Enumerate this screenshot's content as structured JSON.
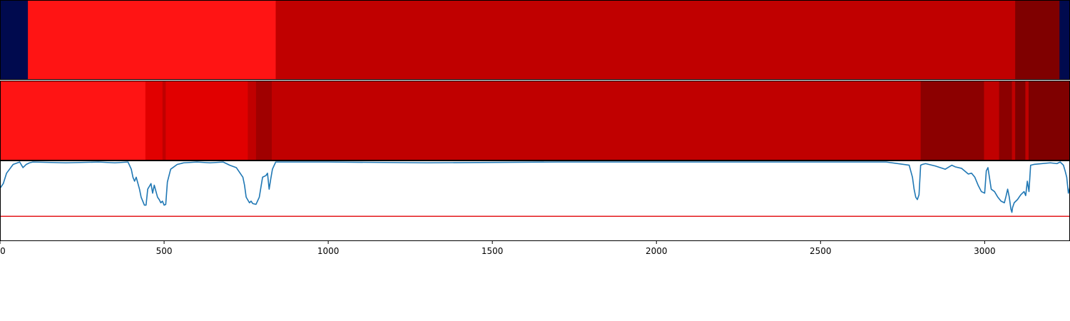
{
  "chart_data": {
    "type": "heatmap",
    "x_ticks": [
      0,
      500,
      1000,
      1500,
      2000,
      2500,
      3000
    ],
    "xlim": [
      0,
      3260
    ],
    "colors": {
      "navy": "#000a4e",
      "bright_red": "#ff1414",
      "red": "#e10000",
      "mid_red": "#c00000",
      "dark_red": "#a00000",
      "darker_red": "#8c0000",
      "deepest_red": "#7f0000",
      "line": "#1f77b4",
      "threshold": "#e41a1c"
    },
    "band_top": [
      {
        "start": 0,
        "end": 85,
        "color": "navy"
      },
      {
        "start": 85,
        "end": 840,
        "color": "bright_red"
      },
      {
        "start": 840,
        "end": 3093,
        "color": "mid_red"
      },
      {
        "start": 3093,
        "end": 3228,
        "color": "deepest_red"
      },
      {
        "start": 3228,
        "end": 3260,
        "color": "navy"
      }
    ],
    "band_middle": [
      {
        "start": 0,
        "end": 443,
        "color": "bright_red"
      },
      {
        "start": 443,
        "end": 495,
        "color": "red"
      },
      {
        "start": 495,
        "end": 505,
        "color": "mid_red"
      },
      {
        "start": 505,
        "end": 755,
        "color": "red"
      },
      {
        "start": 755,
        "end": 780,
        "color": "mid_red"
      },
      {
        "start": 780,
        "end": 828,
        "color": "dark_red"
      },
      {
        "start": 828,
        "end": 2805,
        "color": "mid_red"
      },
      {
        "start": 2805,
        "end": 2998,
        "color": "darker_red"
      },
      {
        "start": 2998,
        "end": 3044,
        "color": "mid_red"
      },
      {
        "start": 3044,
        "end": 3083,
        "color": "darker_red"
      },
      {
        "start": 3083,
        "end": 3093,
        "color": "mid_red"
      },
      {
        "start": 3093,
        "end": 3124,
        "color": "deepest_red"
      },
      {
        "start": 3124,
        "end": 3134,
        "color": "mid_red"
      },
      {
        "start": 3134,
        "end": 3260,
        "color": "deepest_red"
      }
    ],
    "line_series": {
      "ylim": [
        0,
        1
      ],
      "threshold": 0.31,
      "x": [
        0,
        10,
        20,
        40,
        60,
        70,
        80,
        90,
        100,
        200,
        300,
        350,
        390,
        400,
        405,
        410,
        415,
        425,
        430,
        440,
        445,
        450,
        460,
        465,
        470,
        480,
        485,
        490,
        495,
        500,
        505,
        510,
        520,
        540,
        560,
        600,
        640,
        680,
        700,
        720,
        740,
        745,
        750,
        760,
        765,
        770,
        780,
        790,
        800,
        810,
        815,
        820,
        825,
        830,
        840,
        1000,
        1300,
        1700,
        2200,
        2700,
        2770,
        2780,
        2785,
        2790,
        2795,
        2800,
        2805,
        2810,
        2820,
        2850,
        2880,
        2900,
        2910,
        2930,
        2950,
        2960,
        2970,
        2980,
        2990,
        3000,
        3005,
        3010,
        3020,
        3030,
        3040,
        3050,
        3060,
        3065,
        3070,
        3075,
        3080,
        3083,
        3085,
        3090,
        3095,
        3100,
        3110,
        3120,
        3125,
        3130,
        3135,
        3140,
        3150,
        3200,
        3220,
        3230,
        3240,
        3245,
        3250,
        3255,
        3260
      ],
      "y": [
        0.66,
        0.72,
        0.85,
        0.96,
        0.99,
        0.92,
        0.96,
        0.98,
        0.99,
        0.98,
        0.99,
        0.98,
        0.99,
        0.9,
        0.8,
        0.75,
        0.8,
        0.65,
        0.55,
        0.45,
        0.45,
        0.65,
        0.72,
        0.6,
        0.7,
        0.55,
        0.52,
        0.48,
        0.5,
        0.45,
        0.46,
        0.74,
        0.9,
        0.96,
        0.98,
        0.99,
        0.98,
        0.99,
        0.95,
        0.92,
        0.8,
        0.7,
        0.55,
        0.48,
        0.5,
        0.47,
        0.46,
        0.55,
        0.8,
        0.82,
        0.85,
        0.65,
        0.78,
        0.9,
        0.99,
        0.99,
        0.98,
        0.99,
        0.99,
        0.99,
        0.95,
        0.8,
        0.65,
        0.55,
        0.52,
        0.58,
        0.95,
        0.96,
        0.97,
        0.94,
        0.9,
        0.95,
        0.93,
        0.91,
        0.84,
        0.85,
        0.8,
        0.7,
        0.62,
        0.6,
        0.88,
        0.92,
        0.65,
        0.62,
        0.55,
        0.5,
        0.48,
        0.56,
        0.65,
        0.55,
        0.4,
        0.36,
        0.42,
        0.48,
        0.5,
        0.52,
        0.58,
        0.62,
        0.57,
        0.75,
        0.62,
        0.95,
        0.96,
        0.98,
        0.97,
        0.99,
        0.95,
        0.88,
        0.8,
        0.6,
        0.68
      ]
    }
  }
}
